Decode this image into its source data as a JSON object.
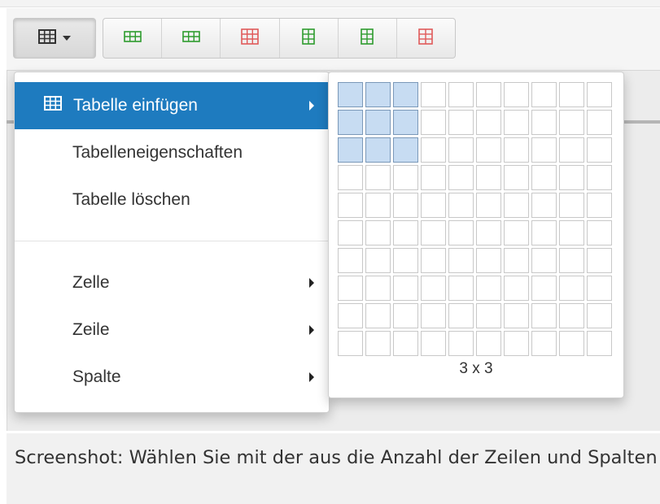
{
  "toolbar": {
    "buttons": [
      {
        "icon": "table-insert-row-before-icon",
        "color": "#2e9c2e"
      },
      {
        "icon": "table-insert-row-after-icon",
        "color": "#2e9c2e"
      },
      {
        "icon": "table-delete-row-icon",
        "color": "#e05a5a"
      },
      {
        "icon": "table-insert-col-before-icon",
        "color": "#2e9c2e"
      },
      {
        "icon": "table-insert-col-after-icon",
        "color": "#2e9c2e"
      },
      {
        "icon": "table-delete-col-icon",
        "color": "#e05a5a"
      }
    ]
  },
  "menu": {
    "items": [
      {
        "label": "Tabelle einfügen",
        "active": true,
        "submenu": true
      },
      {
        "label": "Tabelleneigenschaften",
        "submenu": false
      },
      {
        "label": "Tabelle löschen",
        "submenu": false
      },
      {
        "label": "Zelle",
        "submenu": true
      },
      {
        "label": "Zeile",
        "submenu": true
      },
      {
        "label": "Spalte",
        "submenu": true
      }
    ]
  },
  "grid_picker": {
    "rows": 10,
    "cols": 10,
    "selected_rows": 3,
    "selected_cols": 3,
    "size_label": "3 x 3"
  },
  "colors": {
    "accent": "#1e7bbf",
    "selected_cell": "#c7dcf2",
    "add": "#2e9c2e",
    "delete": "#e05a5a"
  },
  "caption": {
    "text": "Screenshot: Wählen Sie mit der aus die Anzahl der Zeilen und Spalten"
  }
}
